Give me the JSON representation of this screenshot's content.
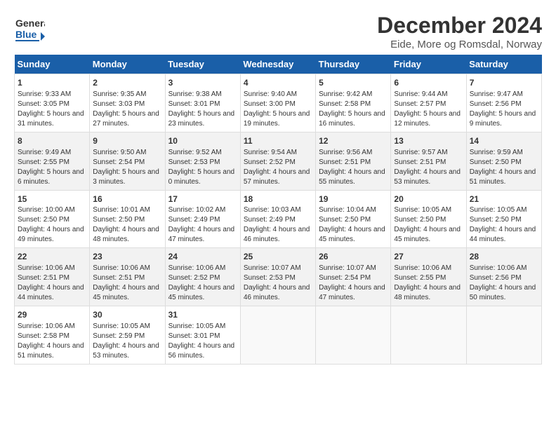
{
  "header": {
    "logo_line1": "General",
    "logo_line2": "Blue",
    "month": "December 2024",
    "location": "Eide, More og Romsdal, Norway"
  },
  "days_of_week": [
    "Sunday",
    "Monday",
    "Tuesday",
    "Wednesday",
    "Thursday",
    "Friday",
    "Saturday"
  ],
  "weeks": [
    [
      {
        "day": "1",
        "sunrise": "Sunrise: 9:33 AM",
        "sunset": "Sunset: 3:05 PM",
        "daylight": "Daylight: 5 hours and 31 minutes."
      },
      {
        "day": "2",
        "sunrise": "Sunrise: 9:35 AM",
        "sunset": "Sunset: 3:03 PM",
        "daylight": "Daylight: 5 hours and 27 minutes."
      },
      {
        "day": "3",
        "sunrise": "Sunrise: 9:38 AM",
        "sunset": "Sunset: 3:01 PM",
        "daylight": "Daylight: 5 hours and 23 minutes."
      },
      {
        "day": "4",
        "sunrise": "Sunrise: 9:40 AM",
        "sunset": "Sunset: 3:00 PM",
        "daylight": "Daylight: 5 hours and 19 minutes."
      },
      {
        "day": "5",
        "sunrise": "Sunrise: 9:42 AM",
        "sunset": "Sunset: 2:58 PM",
        "daylight": "Daylight: 5 hours and 16 minutes."
      },
      {
        "day": "6",
        "sunrise": "Sunrise: 9:44 AM",
        "sunset": "Sunset: 2:57 PM",
        "daylight": "Daylight: 5 hours and 12 minutes."
      },
      {
        "day": "7",
        "sunrise": "Sunrise: 9:47 AM",
        "sunset": "Sunset: 2:56 PM",
        "daylight": "Daylight: 5 hours and 9 minutes."
      }
    ],
    [
      {
        "day": "8",
        "sunrise": "Sunrise: 9:49 AM",
        "sunset": "Sunset: 2:55 PM",
        "daylight": "Daylight: 5 hours and 6 minutes."
      },
      {
        "day": "9",
        "sunrise": "Sunrise: 9:50 AM",
        "sunset": "Sunset: 2:54 PM",
        "daylight": "Daylight: 5 hours and 3 minutes."
      },
      {
        "day": "10",
        "sunrise": "Sunrise: 9:52 AM",
        "sunset": "Sunset: 2:53 PM",
        "daylight": "Daylight: 5 hours and 0 minutes."
      },
      {
        "day": "11",
        "sunrise": "Sunrise: 9:54 AM",
        "sunset": "Sunset: 2:52 PM",
        "daylight": "Daylight: 4 hours and 57 minutes."
      },
      {
        "day": "12",
        "sunrise": "Sunrise: 9:56 AM",
        "sunset": "Sunset: 2:51 PM",
        "daylight": "Daylight: 4 hours and 55 minutes."
      },
      {
        "day": "13",
        "sunrise": "Sunrise: 9:57 AM",
        "sunset": "Sunset: 2:51 PM",
        "daylight": "Daylight: 4 hours and 53 minutes."
      },
      {
        "day": "14",
        "sunrise": "Sunrise: 9:59 AM",
        "sunset": "Sunset: 2:50 PM",
        "daylight": "Daylight: 4 hours and 51 minutes."
      }
    ],
    [
      {
        "day": "15",
        "sunrise": "Sunrise: 10:00 AM",
        "sunset": "Sunset: 2:50 PM",
        "daylight": "Daylight: 4 hours and 49 minutes."
      },
      {
        "day": "16",
        "sunrise": "Sunrise: 10:01 AM",
        "sunset": "Sunset: 2:50 PM",
        "daylight": "Daylight: 4 hours and 48 minutes."
      },
      {
        "day": "17",
        "sunrise": "Sunrise: 10:02 AM",
        "sunset": "Sunset: 2:49 PM",
        "daylight": "Daylight: 4 hours and 47 minutes."
      },
      {
        "day": "18",
        "sunrise": "Sunrise: 10:03 AM",
        "sunset": "Sunset: 2:49 PM",
        "daylight": "Daylight: 4 hours and 46 minutes."
      },
      {
        "day": "19",
        "sunrise": "Sunrise: 10:04 AM",
        "sunset": "Sunset: 2:50 PM",
        "daylight": "Daylight: 4 hours and 45 minutes."
      },
      {
        "day": "20",
        "sunrise": "Sunrise: 10:05 AM",
        "sunset": "Sunset: 2:50 PM",
        "daylight": "Daylight: 4 hours and 45 minutes."
      },
      {
        "day": "21",
        "sunrise": "Sunrise: 10:05 AM",
        "sunset": "Sunset: 2:50 PM",
        "daylight": "Daylight: 4 hours and 44 minutes."
      }
    ],
    [
      {
        "day": "22",
        "sunrise": "Sunrise: 10:06 AM",
        "sunset": "Sunset: 2:51 PM",
        "daylight": "Daylight: 4 hours and 44 minutes."
      },
      {
        "day": "23",
        "sunrise": "Sunrise: 10:06 AM",
        "sunset": "Sunset: 2:51 PM",
        "daylight": "Daylight: 4 hours and 45 minutes."
      },
      {
        "day": "24",
        "sunrise": "Sunrise: 10:06 AM",
        "sunset": "Sunset: 2:52 PM",
        "daylight": "Daylight: 4 hours and 45 minutes."
      },
      {
        "day": "25",
        "sunrise": "Sunrise: 10:07 AM",
        "sunset": "Sunset: 2:53 PM",
        "daylight": "Daylight: 4 hours and 46 minutes."
      },
      {
        "day": "26",
        "sunrise": "Sunrise: 10:07 AM",
        "sunset": "Sunset: 2:54 PM",
        "daylight": "Daylight: 4 hours and 47 minutes."
      },
      {
        "day": "27",
        "sunrise": "Sunrise: 10:06 AM",
        "sunset": "Sunset: 2:55 PM",
        "daylight": "Daylight: 4 hours and 48 minutes."
      },
      {
        "day": "28",
        "sunrise": "Sunrise: 10:06 AM",
        "sunset": "Sunset: 2:56 PM",
        "daylight": "Daylight: 4 hours and 50 minutes."
      }
    ],
    [
      {
        "day": "29",
        "sunrise": "Sunrise: 10:06 AM",
        "sunset": "Sunset: 2:58 PM",
        "daylight": "Daylight: 4 hours and 51 minutes."
      },
      {
        "day": "30",
        "sunrise": "Sunrise: 10:05 AM",
        "sunset": "Sunset: 2:59 PM",
        "daylight": "Daylight: 4 hours and 53 minutes."
      },
      {
        "day": "31",
        "sunrise": "Sunrise: 10:05 AM",
        "sunset": "Sunset: 3:01 PM",
        "daylight": "Daylight: 4 hours and 56 minutes."
      },
      null,
      null,
      null,
      null
    ]
  ]
}
